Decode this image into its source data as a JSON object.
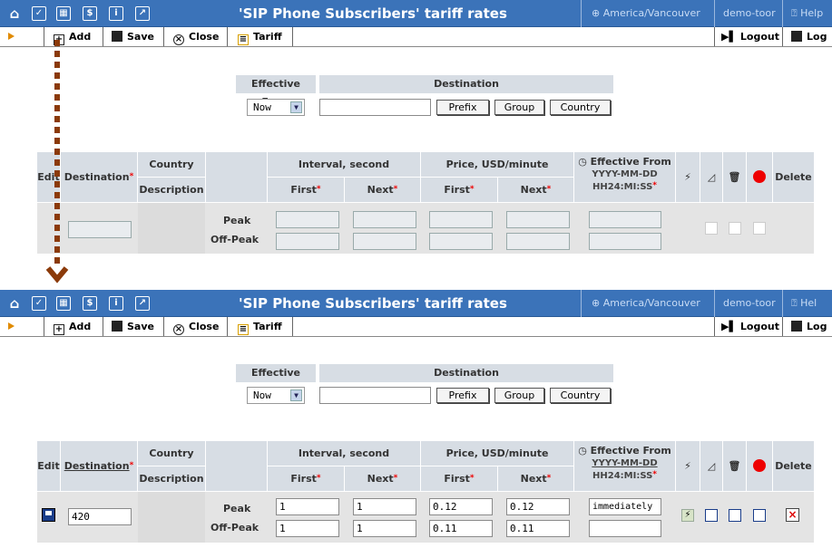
{
  "header": {
    "title": "'SIP Phone Subscribers' tariff rates",
    "timezone": "America/Vancouver",
    "user": "demo-toor",
    "help": "Help",
    "help_cut": "Hel"
  },
  "toolbar": {
    "add": "Add",
    "save": "Save",
    "close": "Close",
    "tariff": "Tariff",
    "logout": "Logout",
    "log": "Log"
  },
  "filter": {
    "effective_from_label": "Effective From",
    "destination_label": "Destination",
    "effective_value": "Now",
    "destination_value": "",
    "prefix_btn": "Prefix",
    "group_btn": "Group",
    "country_btn": "Country"
  },
  "table": {
    "edit": "Edit",
    "destination": "Destination",
    "country": "Country",
    "description": "Description",
    "interval": "Interval, second",
    "price": "Price, USD/minute",
    "first": "First",
    "next": "Next",
    "effective_from": "Effective From",
    "date_format_1": "YYYY-MM-DD",
    "date_format_2": "HH24:MI:SS",
    "delete": "Delete",
    "peak": "Peak",
    "off_peak": "Off-Peak"
  },
  "row_empty": {
    "destination": "",
    "peak_interval_first": "",
    "peak_interval_next": "",
    "peak_price_first": "",
    "peak_price_next": "",
    "peak_effective": "",
    "off_interval_first": "",
    "off_interval_next": "",
    "off_price_first": "",
    "off_price_next": "",
    "off_effective": ""
  },
  "row_filled": {
    "destination": "420",
    "peak_interval_first": "1",
    "peak_interval_next": "1",
    "peak_price_first": "0.12",
    "peak_price_next": "0.12",
    "peak_effective": "immediately",
    "off_interval_first": "1",
    "off_interval_next": "1",
    "off_price_first": "0.11",
    "off_price_next": "0.11",
    "off_effective": ""
  },
  "colors": {
    "header_bg": "#3b73b9",
    "grid_header": "#d7dde4",
    "connector": "#8b3a0a"
  }
}
